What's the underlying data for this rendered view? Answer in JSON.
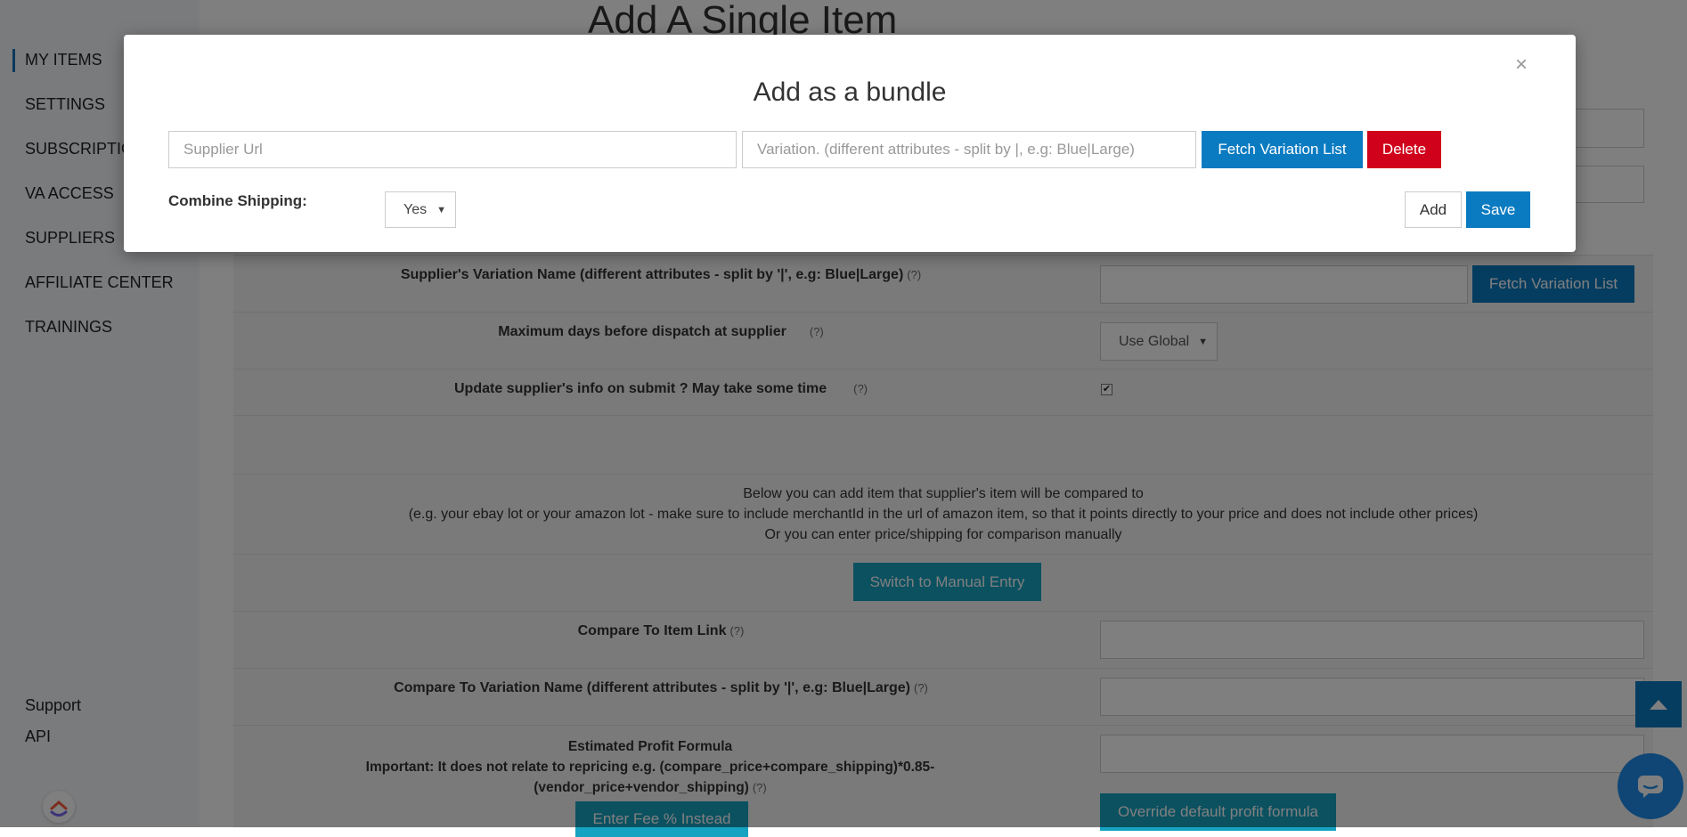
{
  "sidebar": {
    "items": [
      {
        "label": "MY ITEMS"
      },
      {
        "label": "SETTINGS"
      },
      {
        "label": "SUBSCRIPTIO"
      },
      {
        "label": "VA ACCESS"
      },
      {
        "label": "SUPPLIERS"
      },
      {
        "label": "AFFILIATE CENTER"
      },
      {
        "label": "TRAININGS"
      }
    ],
    "bottom_links": [
      {
        "label": "Support"
      },
      {
        "label": "API"
      }
    ]
  },
  "page": {
    "title": "Add A Single Item",
    "supplier_variation_label": "Supplier's Variation Name (different attributes - split by '|', e.g: Blue|Large)",
    "fetch_variation_label": "Fetch Variation List",
    "max_days_label": "Maximum days before dispatch at supplier",
    "max_days_value": "Use Global",
    "update_info_label": "Update supplier's info on submit ? May take some time",
    "update_info_checked": "✔",
    "info_line_1": "Below you can add item that supplier's item will be compared to",
    "info_line_2": "(e.g. your ebay lot or your amazon lot - make sure to include merchantId in the url of amazon item, so that it points directly to your price and does not include other prices)",
    "info_line_3": "Or you can enter price/shipping for comparison manually",
    "switch_manual_label": "Switch to Manual Entry",
    "compare_link_label": "Compare To Item Link",
    "compare_variation_label": "Compare To Variation Name (different attributes - split by '|', e.g: Blue|Large)",
    "profit_formula_title": "Estimated Profit Formula",
    "profit_formula_note_1": "Important: It does not relate to repricing e.g. (compare_price+compare_shipping)*0.85-",
    "profit_formula_note_2": "(vendor_price+vendor_shipping)",
    "help_mark": "(?)",
    "enter_fee_label": "Enter Fee % Instead",
    "override_formula_label": "Override default profit formula"
  },
  "modal": {
    "title": "Add as a bundle",
    "close_glyph": "×",
    "supplier_url_placeholder": "Supplier Url",
    "variation_placeholder": "Variation. (different attributes - split by |, e.g: Blue|Large)",
    "fetch_button": "Fetch Variation List",
    "delete_button": "Delete",
    "combine_shipping_label": "Combine Shipping:",
    "combine_shipping_value": "Yes",
    "add_button": "Add",
    "save_button": "Save"
  },
  "colors": {
    "primary": "#0b7bc1",
    "teal": "#16a2c1",
    "danger": "#d0021b",
    "sidebar_bg": "#f4f7fb"
  },
  "icons": {
    "scroll_top": "chevron-up-icon",
    "chat": "chat-icon",
    "logo": "clickup-logo-icon",
    "caret": "caret-down-icon"
  }
}
